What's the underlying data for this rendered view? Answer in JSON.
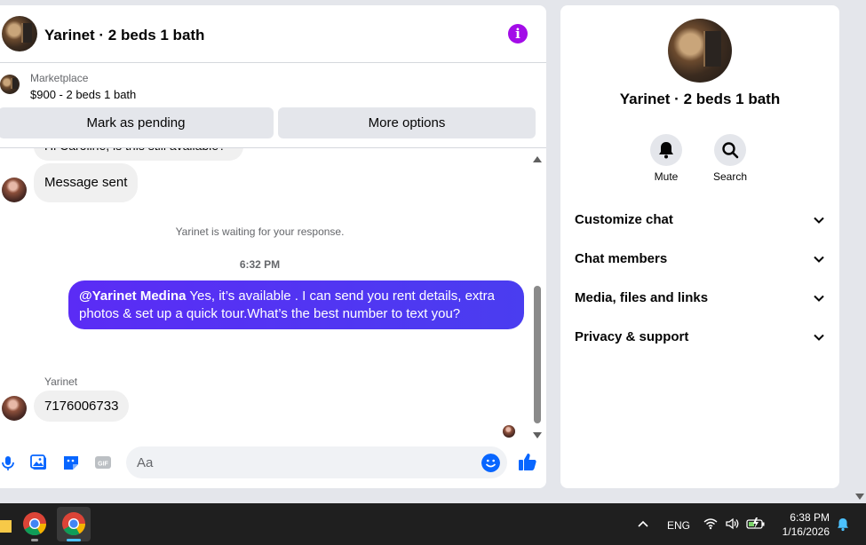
{
  "conversation": {
    "title": "Yarinet · 2 beds 1 bath",
    "info_icon": "info-icon"
  },
  "marketplace": {
    "label": "Marketplace",
    "listing": "$900 - 2 beds 1 bath",
    "mark_pending_label": "Mark as pending",
    "more_options_label": "More options"
  },
  "messages": {
    "partial_text": "Hi Caroline, is this still available?",
    "sent_confirmation": "Message sent",
    "waiting_notice": "Yarinet is waiting for your response.",
    "timestamp": "6:32 PM",
    "outgoing_mention": "@Yarinet Medina",
    "outgoing_text": " Yes, it’s available .  I can send you rent details, extra photos & set up a quick tour.What’s the best number to text you?",
    "incoming_sender": "Yarinet",
    "incoming_text": "7176006733"
  },
  "composer": {
    "placeholder": "Aa",
    "value": "",
    "icons": [
      "microphone-icon",
      "photo-icon",
      "sticker-icon",
      "gif-icon",
      "emoji-icon",
      "like-icon"
    ]
  },
  "info_panel": {
    "title": "Yarinet · 2 beds 1 bath",
    "mute_label": "Mute",
    "search_label": "Search",
    "sections": [
      "Customize chat",
      "Chat members",
      "Media, files and links",
      "Privacy & support"
    ]
  },
  "taskbar": {
    "language": "ENG",
    "time": "6:38 PM",
    "date": "1/16/2026"
  },
  "colors": {
    "accent": "#0866ff",
    "outgoing_bubble": "#4f35f3",
    "info_icon": "#a30ce8"
  }
}
